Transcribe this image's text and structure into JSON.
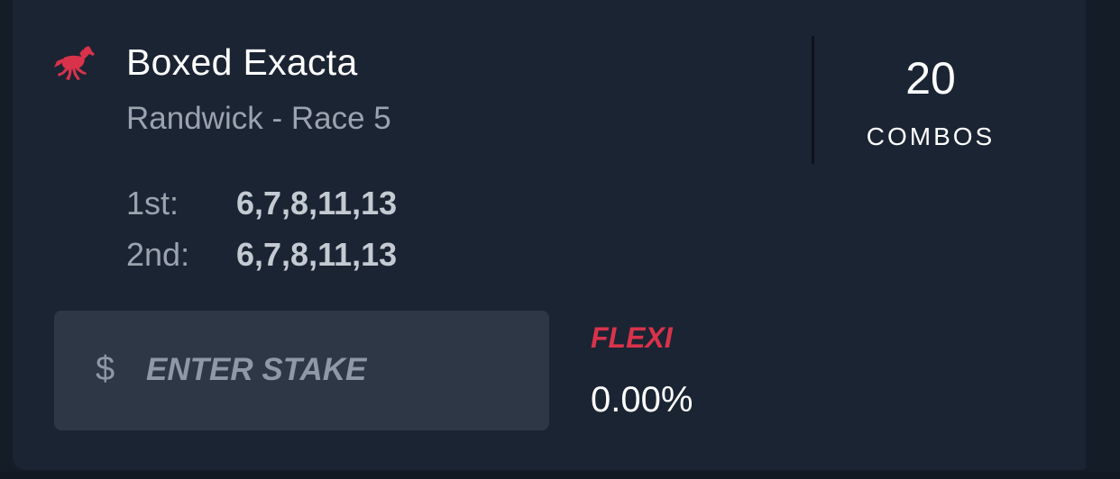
{
  "bet": {
    "title": "Boxed Exacta",
    "venue": "Randwick - Race 5",
    "icon": "horse-racing-icon",
    "icon_color": "#d8334b"
  },
  "combos": {
    "value": "20",
    "label": "COMBOS"
  },
  "selections": [
    {
      "label": "1st:",
      "value": "6,7,8,11,13"
    },
    {
      "label": "2nd:",
      "value": "6,7,8,11,13"
    }
  ],
  "stake": {
    "currency_symbol": "$",
    "placeholder": "ENTER STAKE"
  },
  "flexi": {
    "label": "FLEXI",
    "value": "0.00%"
  },
  "colors": {
    "background": "#141c27",
    "card": "#1b2433",
    "input": "#2e3746",
    "accent": "#d8334b"
  }
}
